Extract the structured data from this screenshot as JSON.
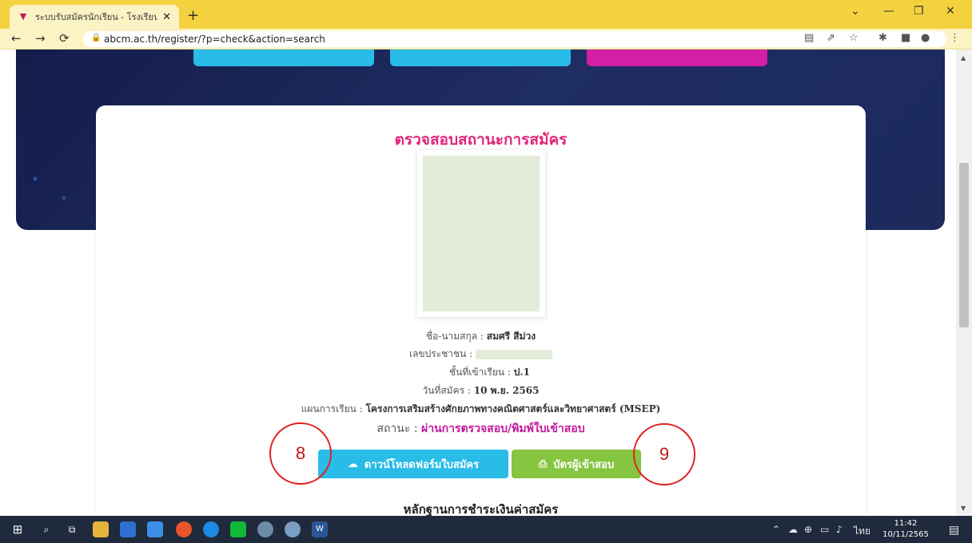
{
  "browser": {
    "tab_title": "ระบบรับสมัครนักเรียน - โรงเรียนอนุบาล",
    "tab_close": "✕",
    "new_tab": "+",
    "url": "abcm.ac.th/register/?p=check&action=search",
    "window_controls": {
      "minimize": "—",
      "restore": "❐",
      "close": "✕",
      "dropdown": "⌄"
    }
  },
  "page": {
    "card_title": "ตรวจสอบสถานะการสมัคร",
    "name_label": "ชื่อ-นามสกุล : ",
    "name_value": "สมศรี สีม่วง",
    "id_label": "เลขประชาชน : ",
    "grade_label": "ชั้นที่เข้าเรียน : ",
    "grade_value": "ป.1",
    "date_label": "วันที่สมัคร : ",
    "date_value": "10 พ.ย. 2565",
    "plan_label": "แผนการเรียน : ",
    "plan_value": "โครงการเสริมสร้างศักยภาพทางคณิตศาสตร์และวิทยาศาสตร์ (MSEP)",
    "status_label": "สถานะ : ",
    "status_value": "ผ่านการตรวจสอบ/พิมพ์ใบเข้าสอบ",
    "download_button": "ดาวน์โหลดฟอร์มใบสมัคร",
    "print_button": "บัตรผู้เข้าสอบ",
    "payment_title": "หลักฐานการชำระเงินค่าสมัคร"
  },
  "annotations": {
    "left_number": "8",
    "right_number": "9"
  },
  "taskbar": {
    "language": "ไทย",
    "time": "11:42",
    "date": "10/11/2565"
  },
  "colors": {
    "tabstrip": "#f4d23f",
    "title_pink": "#e1247a",
    "status_magenta": "#c2179c",
    "download_blue": "#29bce8",
    "print_green": "#86c540"
  }
}
